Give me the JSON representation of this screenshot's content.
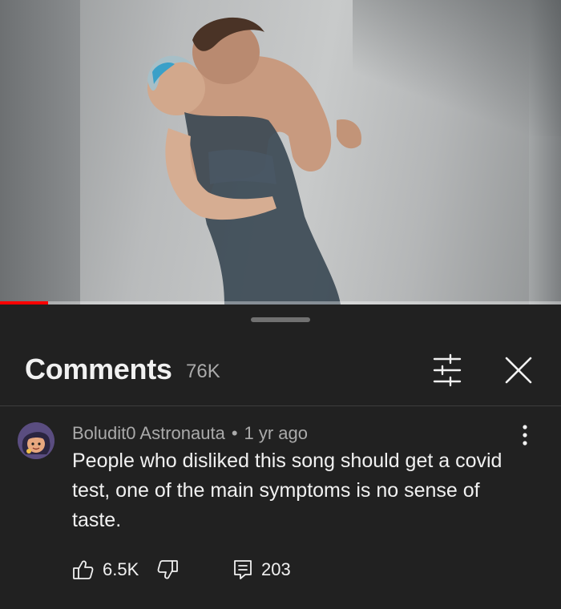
{
  "video": {
    "progress_fraction": 0.085,
    "accent_color": "#ff0000"
  },
  "comments_panel": {
    "title": "Comments",
    "count": "76K",
    "filter_icon": "sliders-icon",
    "close_icon": "close-icon"
  },
  "comment": {
    "author": "Boludit0 Astronauta",
    "separator": "•",
    "timestamp": "1 yr ago",
    "text": "People who disliked this song should get a covid test, one of the main symptoms is no sense of taste.",
    "like_count": "6.5K",
    "reply_count": "203",
    "icons": {
      "like": "thumbs-up-icon",
      "dislike": "thumbs-down-icon",
      "reply": "reply-icon",
      "more": "more-vertical-icon"
    }
  }
}
